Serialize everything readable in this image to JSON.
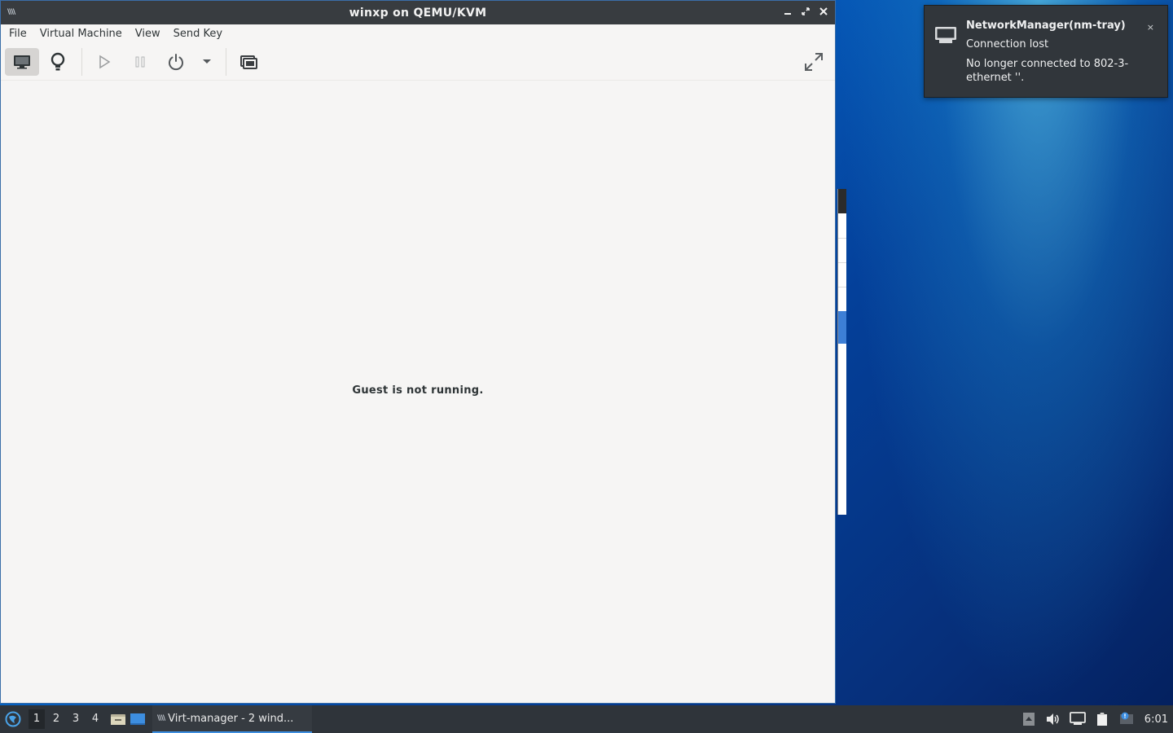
{
  "window": {
    "title": "winxp on QEMU/KVM",
    "menu": [
      "File",
      "Virtual Machine",
      "View",
      "Send Key"
    ],
    "toolbar": {
      "console_icon": "monitor-icon",
      "details_icon": "lightbulb-icon",
      "run_icon": "play-icon",
      "pause_icon": "pause-icon",
      "shutdown_icon": "power-icon",
      "shutdown_menu_icon": "chevron-down-icon",
      "screenshot_icon": "screens-icon",
      "fullscreen_icon": "fullscreen-icon"
    },
    "guest_message": "Guest is not running."
  },
  "notification": {
    "app": "NetworkManager(nm-tray)",
    "summary": "Connection lost",
    "body": "No longer connected to 802-3-ethernet ''.",
    "close_label": "×"
  },
  "taskbar": {
    "workspaces": [
      "1",
      "2",
      "3",
      "4"
    ],
    "task_label": "Virt-manager - 2 wind...",
    "clock": "6:01"
  },
  "colors": {
    "titlebar": "#383c40",
    "window_bg": "#f6f5f4",
    "taskbar": "#2f343a",
    "notification": "#31363b",
    "accent": "#3d8ee0"
  }
}
